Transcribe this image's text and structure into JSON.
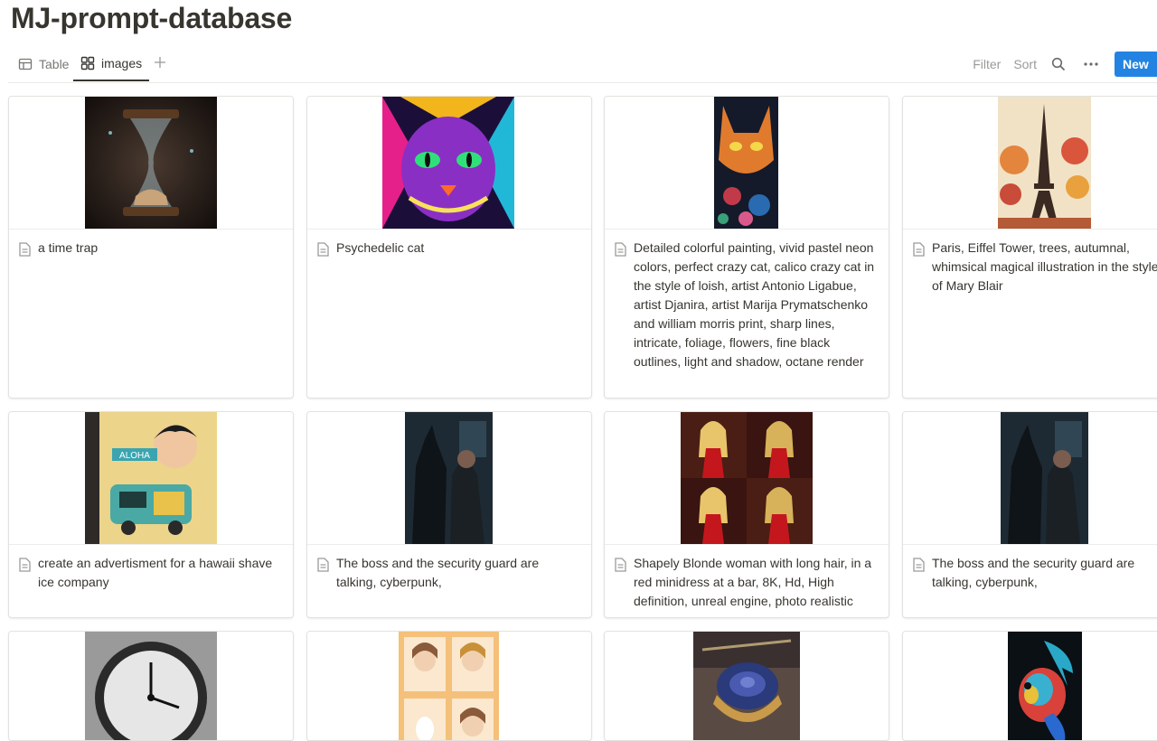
{
  "page": {
    "title": "MJ-prompt-database"
  },
  "views": {
    "table_label": "Table",
    "gallery_label": "images"
  },
  "actions": {
    "filter": "Filter",
    "sort": "Sort",
    "new": "New"
  },
  "icons": [
    "table-icon",
    "gallery-icon",
    "plus-icon",
    "search-icon",
    "more-icon",
    "page-icon"
  ],
  "colors": {
    "accent": "#2383e2",
    "text": "#37352f",
    "muted": "#9b9a97"
  },
  "cards": [
    {
      "caption": "a time trap"
    },
    {
      "caption": "Psychedelic cat"
    },
    {
      "caption": "Detailed colorful painting, vivid pastel neon colors, perfect crazy cat, calico crazy cat in the style of loish, artist Antonio Ligabue, artist Djanira, artist Marija Prymatschenko and william morris print, sharp lines, intricate, foliage, flowers, fine black outlines, light and shadow, octane render"
    },
    {
      "caption": "Paris, Eiffel Tower, trees, autumnal, whimsical magical illustration in the style of Mary Blair"
    },
    {
      "caption": "create an advertisment for a hawaii shave ice company"
    },
    {
      "caption": "The boss and the security guard are talking, cyberpunk,"
    },
    {
      "caption": "Shapely Blonde woman with long hair, in a red minidress at a bar, 8K, Hd, High definition, unreal engine, photo realistic"
    },
    {
      "caption": "The boss and the security guard are talking, cyberpunk,"
    },
    {
      "caption": ""
    },
    {
      "caption": ""
    },
    {
      "caption": ""
    },
    {
      "caption": ""
    }
  ]
}
